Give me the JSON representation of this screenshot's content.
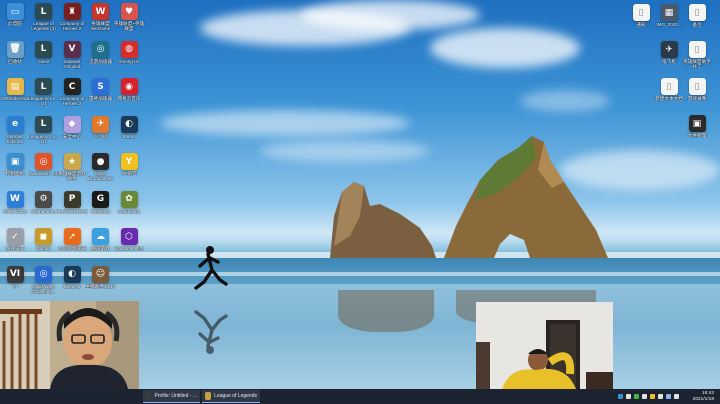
{
  "desktop": {
    "left_icons": [
      {
        "label": "此电脑",
        "icon": "computer-icon",
        "color": "#3d8fd8",
        "glyph": "▭"
      },
      {
        "label": "League of Legends (3)",
        "icon": "league-icon",
        "color": "#2b4a52",
        "glyph": "L"
      },
      {
        "label": "Company of Heroes 2",
        "icon": "game-icon",
        "color": "#7a1f1f",
        "glyph": "♜"
      },
      {
        "label": "英雄联盟WeGame",
        "icon": "wegame-icon",
        "color": "#c8352d",
        "glyph": "W"
      },
      {
        "label": "英雄联盟+英雄联盟",
        "icon": "hero-icon",
        "color": "#d9534f",
        "glyph": "♥"
      },
      {
        "label": "回收站",
        "icon": "recycle-bin-icon",
        "color": "#6aa0c8",
        "glyph": "🗑"
      },
      {
        "label": "Client",
        "icon": "league-client-icon",
        "color": "#2b4a52",
        "glyph": "L"
      },
      {
        "label": "Valorant Original",
        "icon": "valorant-icon",
        "color": "#5a2d4a",
        "glyph": "V"
      },
      {
        "label": "迅游加速器",
        "icon": "accelerator-icon",
        "color": "#1f6f8b",
        "glyph": "◎"
      },
      {
        "label": "Among Us",
        "icon": "among-us-icon",
        "color": "#d42d2d",
        "glyph": "◍"
      },
      {
        "label": "Defender.exe",
        "icon": "folder-icon",
        "color": "#e6b84a",
        "glyph": "▤"
      },
      {
        "label": "League of Le... (2)",
        "icon": "league2-icon",
        "color": "#2b4a52",
        "glyph": "L"
      },
      {
        "label": "Company of Heroes 2",
        "icon": "coh2-icon",
        "color": "#222222",
        "glyph": "C"
      },
      {
        "label": "雷神加速器",
        "icon": "thunder-icon",
        "color": "#2d6fd8",
        "glyph": "S"
      },
      {
        "label": "网易云音乐",
        "icon": "netease-music-icon",
        "color": "#d8202d",
        "glyph": "◉"
      },
      {
        "label": "Internet Explorer",
        "icon": "ie-icon",
        "color": "#2a7fd0",
        "glyph": "e"
      },
      {
        "label": "League of Le... (1)",
        "icon": "league3-icon",
        "color": "#2b4a52",
        "glyph": "L"
      },
      {
        "label": "安全中心",
        "icon": "security-icon",
        "color": "#b0a0e0",
        "glyph": "◆"
      },
      {
        "label": "小飞机",
        "icon": "fly-icon",
        "color": "#e2782b",
        "glyph": "✈"
      },
      {
        "label": "Steam",
        "icon": "steam-icon",
        "color": "#1b3a5a",
        "glyph": "◐"
      },
      {
        "label": "控制面板",
        "icon": "control-panel-icon",
        "color": "#3a8fd0",
        "glyph": "▣"
      },
      {
        "label": "Overwatch, inc.",
        "icon": "overwatch-icon",
        "color": "#e0542b",
        "glyph": "◎"
      },
      {
        "label": "英雄联盟游戏助手",
        "icon": "assistant-icon",
        "color": "#c8a84a",
        "glyph": "★"
      },
      {
        "label": "Open Broadcaster",
        "icon": "obs-icon",
        "color": "#2a2a2a",
        "glyph": "●"
      },
      {
        "label": "YY语音",
        "icon": "yy-icon",
        "color": "#f0c020",
        "glyph": "Y"
      },
      {
        "label": "WPS Office",
        "icon": "wps-icon",
        "color": "#2d7fd8",
        "glyph": "W"
      },
      {
        "label": "Warhammer",
        "icon": "warhammer-icon",
        "color": "#4a4a4a",
        "glyph": "⚙"
      },
      {
        "label": "PLAYERUNKNOWN'S",
        "icon": "pubg-icon",
        "color": "#3a3a2a",
        "glyph": "P"
      },
      {
        "label": "WeGame",
        "icon": "wegame2-icon",
        "color": "#1a1a1a",
        "glyph": "G"
      },
      {
        "label": "Deadlands",
        "icon": "deadlands-icon",
        "color": "#6a8a3a",
        "glyph": "✿"
      },
      {
        "label": "保存设置",
        "icon": "settings-icon",
        "color": "#9aa0a8",
        "glyph": "✓"
      },
      {
        "label": "Gunfire",
        "icon": "gunfire-icon",
        "color": "#c89a2a",
        "glyph": "◼"
      },
      {
        "label": "小火箭加速器",
        "icon": "rocket-icon",
        "color": "#e86a1a",
        "glyph": "➚"
      },
      {
        "label": "腾讯游戏",
        "icon": "tencent-icon",
        "color": "#3aa0e0",
        "glyph": "☁"
      },
      {
        "label": "WeGame 助手",
        "icon": "helper-icon",
        "color": "#6a2ab0",
        "glyph": "⬡"
      },
      {
        "label": "VI",
        "icon": "vi-icon",
        "color": "#3a3a3a",
        "glyph": "VI"
      },
      {
        "label": "Guild Wars Challenge...",
        "icon": "guild-icon",
        "color": "#2a6ad0",
        "glyph": "◎"
      },
      {
        "label": "Steam 2",
        "icon": "steam2-icon",
        "color": "#1a3a5a",
        "glyph": "◐"
      },
      {
        "label": "主播助手 2017",
        "icon": "streamer-icon",
        "color": "#7a5a3a",
        "glyph": "☺"
      }
    ],
    "right_icons": [
      {
        "label": "通知",
        "icon": "document-icon",
        "color": "#f4f4f4",
        "glyph": "▯"
      },
      {
        "label": "IMG_2020...",
        "icon": "image-icon",
        "color": "#4a5a6a",
        "glyph": "▦"
      },
      {
        "label": "备注",
        "icon": "note-icon",
        "color": "#f4f4f4",
        "glyph": "▯"
      },
      {
        "label": "纸飞机",
        "icon": "paper-plane-icon",
        "color": "#2a3a4a",
        "glyph": "✈"
      },
      {
        "label": "英雄联盟助手补丁",
        "icon": "patch-icon",
        "color": "#f4f4f4",
        "glyph": "▯"
      },
      {
        "label": "新建文本文档",
        "icon": "text-file-icon",
        "color": "#f4f4f4",
        "glyph": "▯"
      },
      {
        "label": "游戏录像",
        "icon": "video-icon",
        "color": "#f4f4f4",
        "glyph": "▯"
      },
      {
        "label": "文件管理",
        "icon": "file-manager-icon",
        "color": "#2a2a2a",
        "glyph": "▣"
      }
    ]
  },
  "taskbar": {
    "buttons": [
      {
        "label": "Profile: Untitled - ...",
        "color": "#3a3a3a"
      },
      {
        "label": "League of Legends",
        "color": "#c8a040"
      }
    ],
    "tray_colors": [
      "#3a8fd0",
      "#e0e0e0",
      "#4ab04a",
      "#e0e0e0",
      "#f0c020",
      "#e0e0e0",
      "#8ab4f8",
      "#e0e0e0"
    ],
    "time": "19:42",
    "date": "2021/1/18"
  }
}
